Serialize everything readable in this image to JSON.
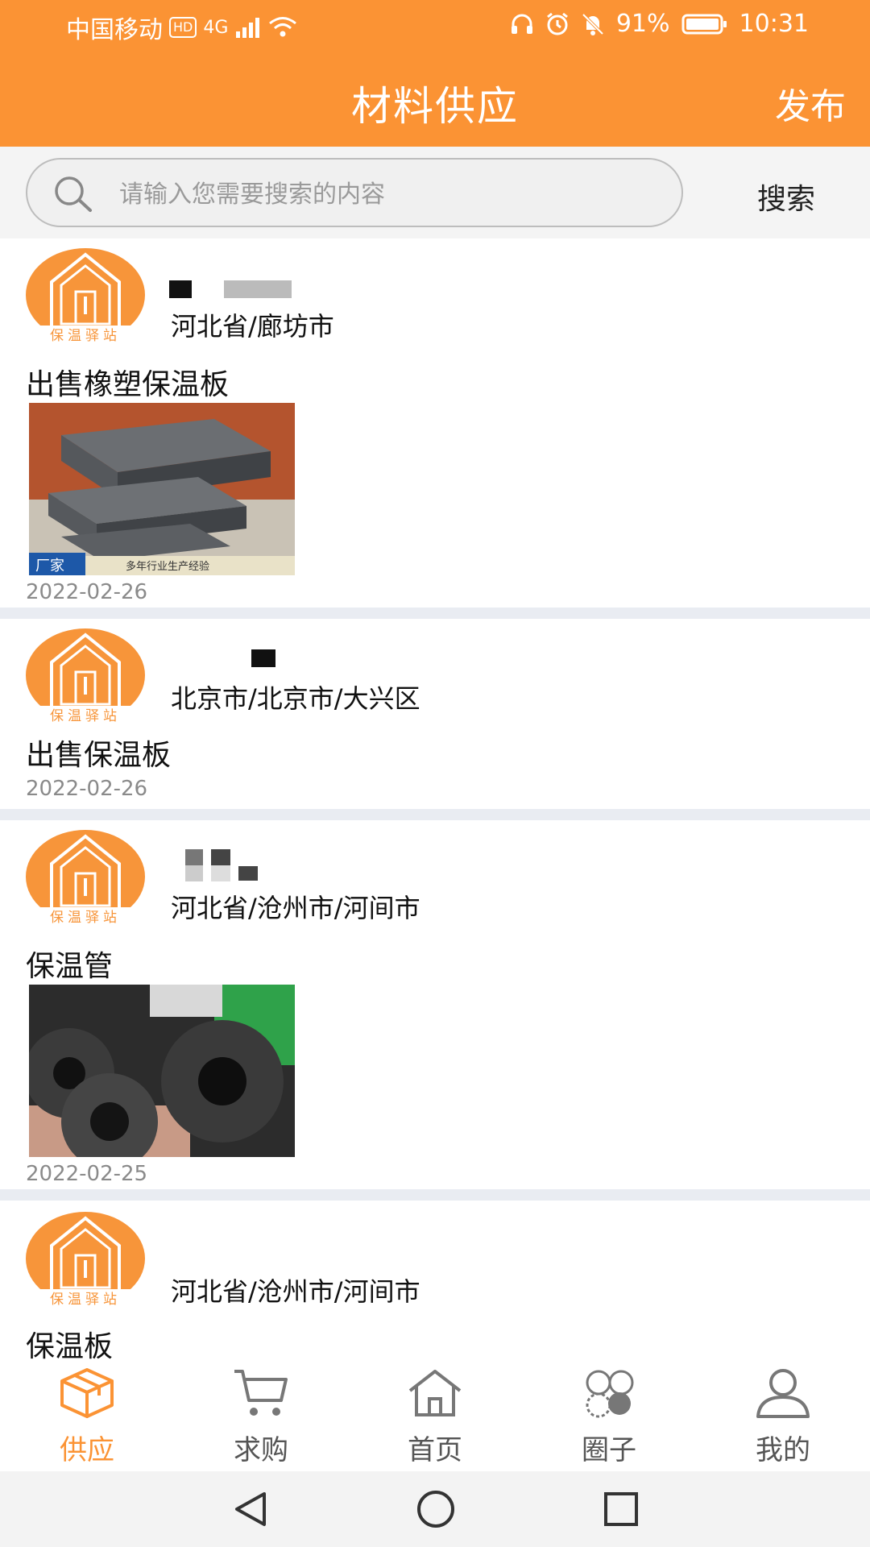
{
  "status_bar": {
    "carrier": "中国移动",
    "hd_badge": "HD",
    "network": "4G",
    "battery": "91%",
    "time": "10:31"
  },
  "header": {
    "title": "材料供应",
    "action_label": "发布"
  },
  "search": {
    "placeholder": "请输入您需要搜索的内容",
    "button_label": "搜索"
  },
  "listings": [
    {
      "location": "河北省/廊坊市",
      "title": "出售橡塑保温板",
      "date": "2022-02-26",
      "has_photo": true,
      "photo_caption_left": "厂家",
      "photo_caption_right": "多年行业生产经验"
    },
    {
      "location": "北京市/北京市/大兴区",
      "title": "出售保温板",
      "date": "2022-02-26",
      "has_photo": false
    },
    {
      "location": "河北省/沧州市/河间市",
      "title": "保温管",
      "date": "2022-02-25",
      "has_photo": true
    },
    {
      "location": "河北省/沧州市/河间市",
      "title": "保温板",
      "date": "",
      "has_photo": true
    }
  ],
  "avatar_logo_text": "保温驿站",
  "tabbar": {
    "items": [
      {
        "label": "供应",
        "icon": "box-icon",
        "active": true
      },
      {
        "label": "求购",
        "icon": "cart-icon",
        "active": false
      },
      {
        "label": "首页",
        "icon": "home-icon",
        "active": false
      },
      {
        "label": "圈子",
        "icon": "circles-icon",
        "active": false
      },
      {
        "label": "我的",
        "icon": "person-icon",
        "active": false
      }
    ]
  },
  "colors": {
    "accent": "#fb9334",
    "inactive_tab": "#555555",
    "date_gray": "#8a8a8a",
    "separator": "#e9ecf2"
  }
}
